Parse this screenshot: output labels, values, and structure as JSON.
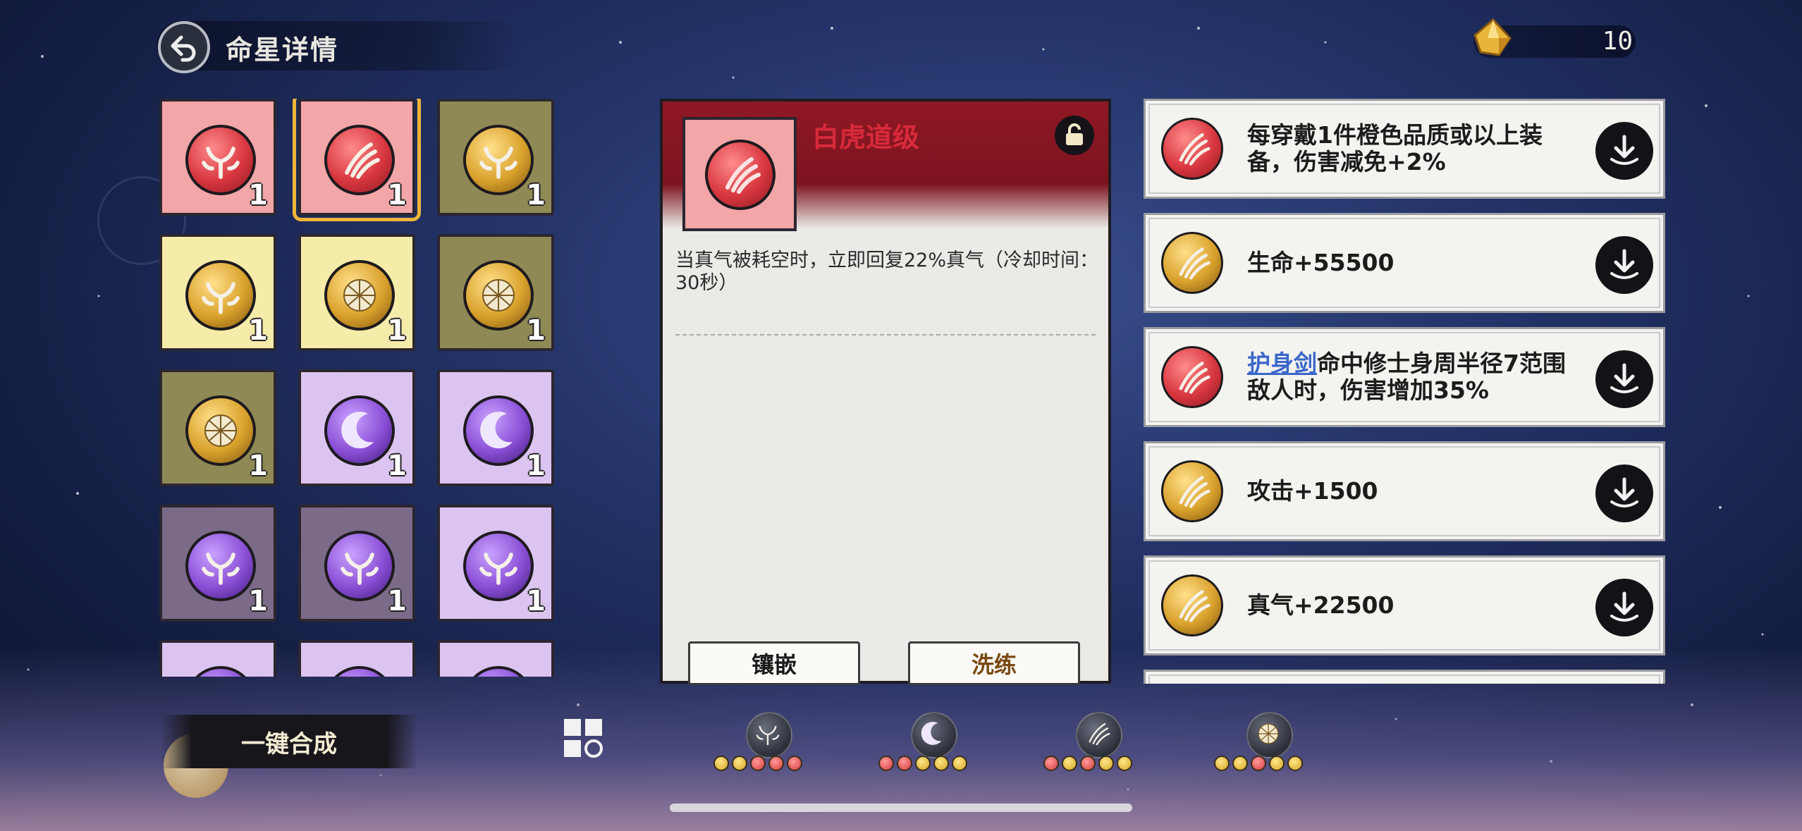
{
  "header": {
    "title": "命星详情",
    "back_icon": "back-arrow-icon",
    "currency_icon": "gold-crystal-icon",
    "currency_value": "10"
  },
  "grid": {
    "cells": [
      {
        "bg": "#f2a6a8",
        "orb": "red",
        "count": "1",
        "symbol": "horns"
      },
      {
        "bg": "#f2a6a8",
        "orb": "red",
        "count": "1",
        "symbol": "claw",
        "selected": true
      },
      {
        "bg": "#8f8a55",
        "orb": "gold",
        "count": "1",
        "symbol": "horns"
      },
      {
        "bg": "#f6ecaa",
        "orb": "gold",
        "count": "1",
        "symbol": "horns"
      },
      {
        "bg": "#f6ecaa",
        "orb": "gold",
        "count": "1",
        "symbol": "shell"
      },
      {
        "bg": "#8f8a55",
        "orb": "gold",
        "count": "1",
        "symbol": "shell"
      },
      {
        "bg": "#8f8a55",
        "orb": "gold",
        "count": "1",
        "symbol": "shell"
      },
      {
        "bg": "#dcc4f0",
        "orb": "purple",
        "count": "1",
        "symbol": "moon"
      },
      {
        "bg": "#dcc4f0",
        "orb": "purple",
        "count": "1",
        "symbol": "moon"
      },
      {
        "bg": "#7b6a88",
        "orb": "purple",
        "count": "1",
        "symbol": "horns"
      },
      {
        "bg": "#7b6a88",
        "orb": "purple",
        "count": "1",
        "symbol": "horns"
      },
      {
        "bg": "#dcc4f0",
        "orb": "purple",
        "count": "1",
        "symbol": "horns"
      },
      {
        "bg": "#dcc4f0",
        "orb": "purple",
        "count": "",
        "symbol": "horns"
      },
      {
        "bg": "#dcc4f0",
        "orb": "purple",
        "count": "",
        "symbol": "horns"
      },
      {
        "bg": "#dcc4f0",
        "orb": "purple",
        "count": "",
        "symbol": "horns"
      }
    ]
  },
  "detail": {
    "name": "白虎道级",
    "icon": "red-claw-orb-icon",
    "lock_icon": "lock-icon",
    "description": "当真气被耗空时，立即回复22%真气（冷却时间：30秒）",
    "inlay_label": "镶嵌",
    "refine_label": "洗练"
  },
  "list": {
    "items": [
      {
        "orb": "red",
        "text": "每穿戴1件橙色品质或以上装备，伤害减免+2%"
      },
      {
        "orb": "gold",
        "text": "生命+55500"
      },
      {
        "orb": "red",
        "link": "护身剑",
        "text": "命中修士身周半径7范围敌人时，伤害增加35%"
      },
      {
        "orb": "gold",
        "text": "攻击+1500"
      },
      {
        "orb": "gold",
        "text": "真气+22500"
      }
    ],
    "equip_icon": "equip-down-arrow-icon"
  },
  "bottom": {
    "merge_label": "一键合成",
    "filter_all_icon": "grid-filter-icon",
    "filters": [
      {
        "icon": "horns-filter-icon",
        "dots": [
          "gold",
          "gold",
          "red",
          "red",
          "red"
        ]
      },
      {
        "icon": "moon-filter-icon",
        "dots": [
          "red",
          "red",
          "gold",
          "gold",
          "gold"
        ]
      },
      {
        "icon": "claw-filter-icon",
        "dots": [
          "red",
          "gold",
          "red",
          "gold",
          "gold"
        ]
      },
      {
        "icon": "shell-filter-icon",
        "dots": [
          "gold",
          "gold",
          "red",
          "gold",
          "gold"
        ]
      }
    ]
  },
  "colors": {
    "red_orb": "#d8373f",
    "gold_orb": "#d9a12c",
    "purple_orb": "#8a4fd6",
    "selected_outline": "#f1b437",
    "detail_header": "#8f1823",
    "detail_name": "#d72a3a"
  }
}
